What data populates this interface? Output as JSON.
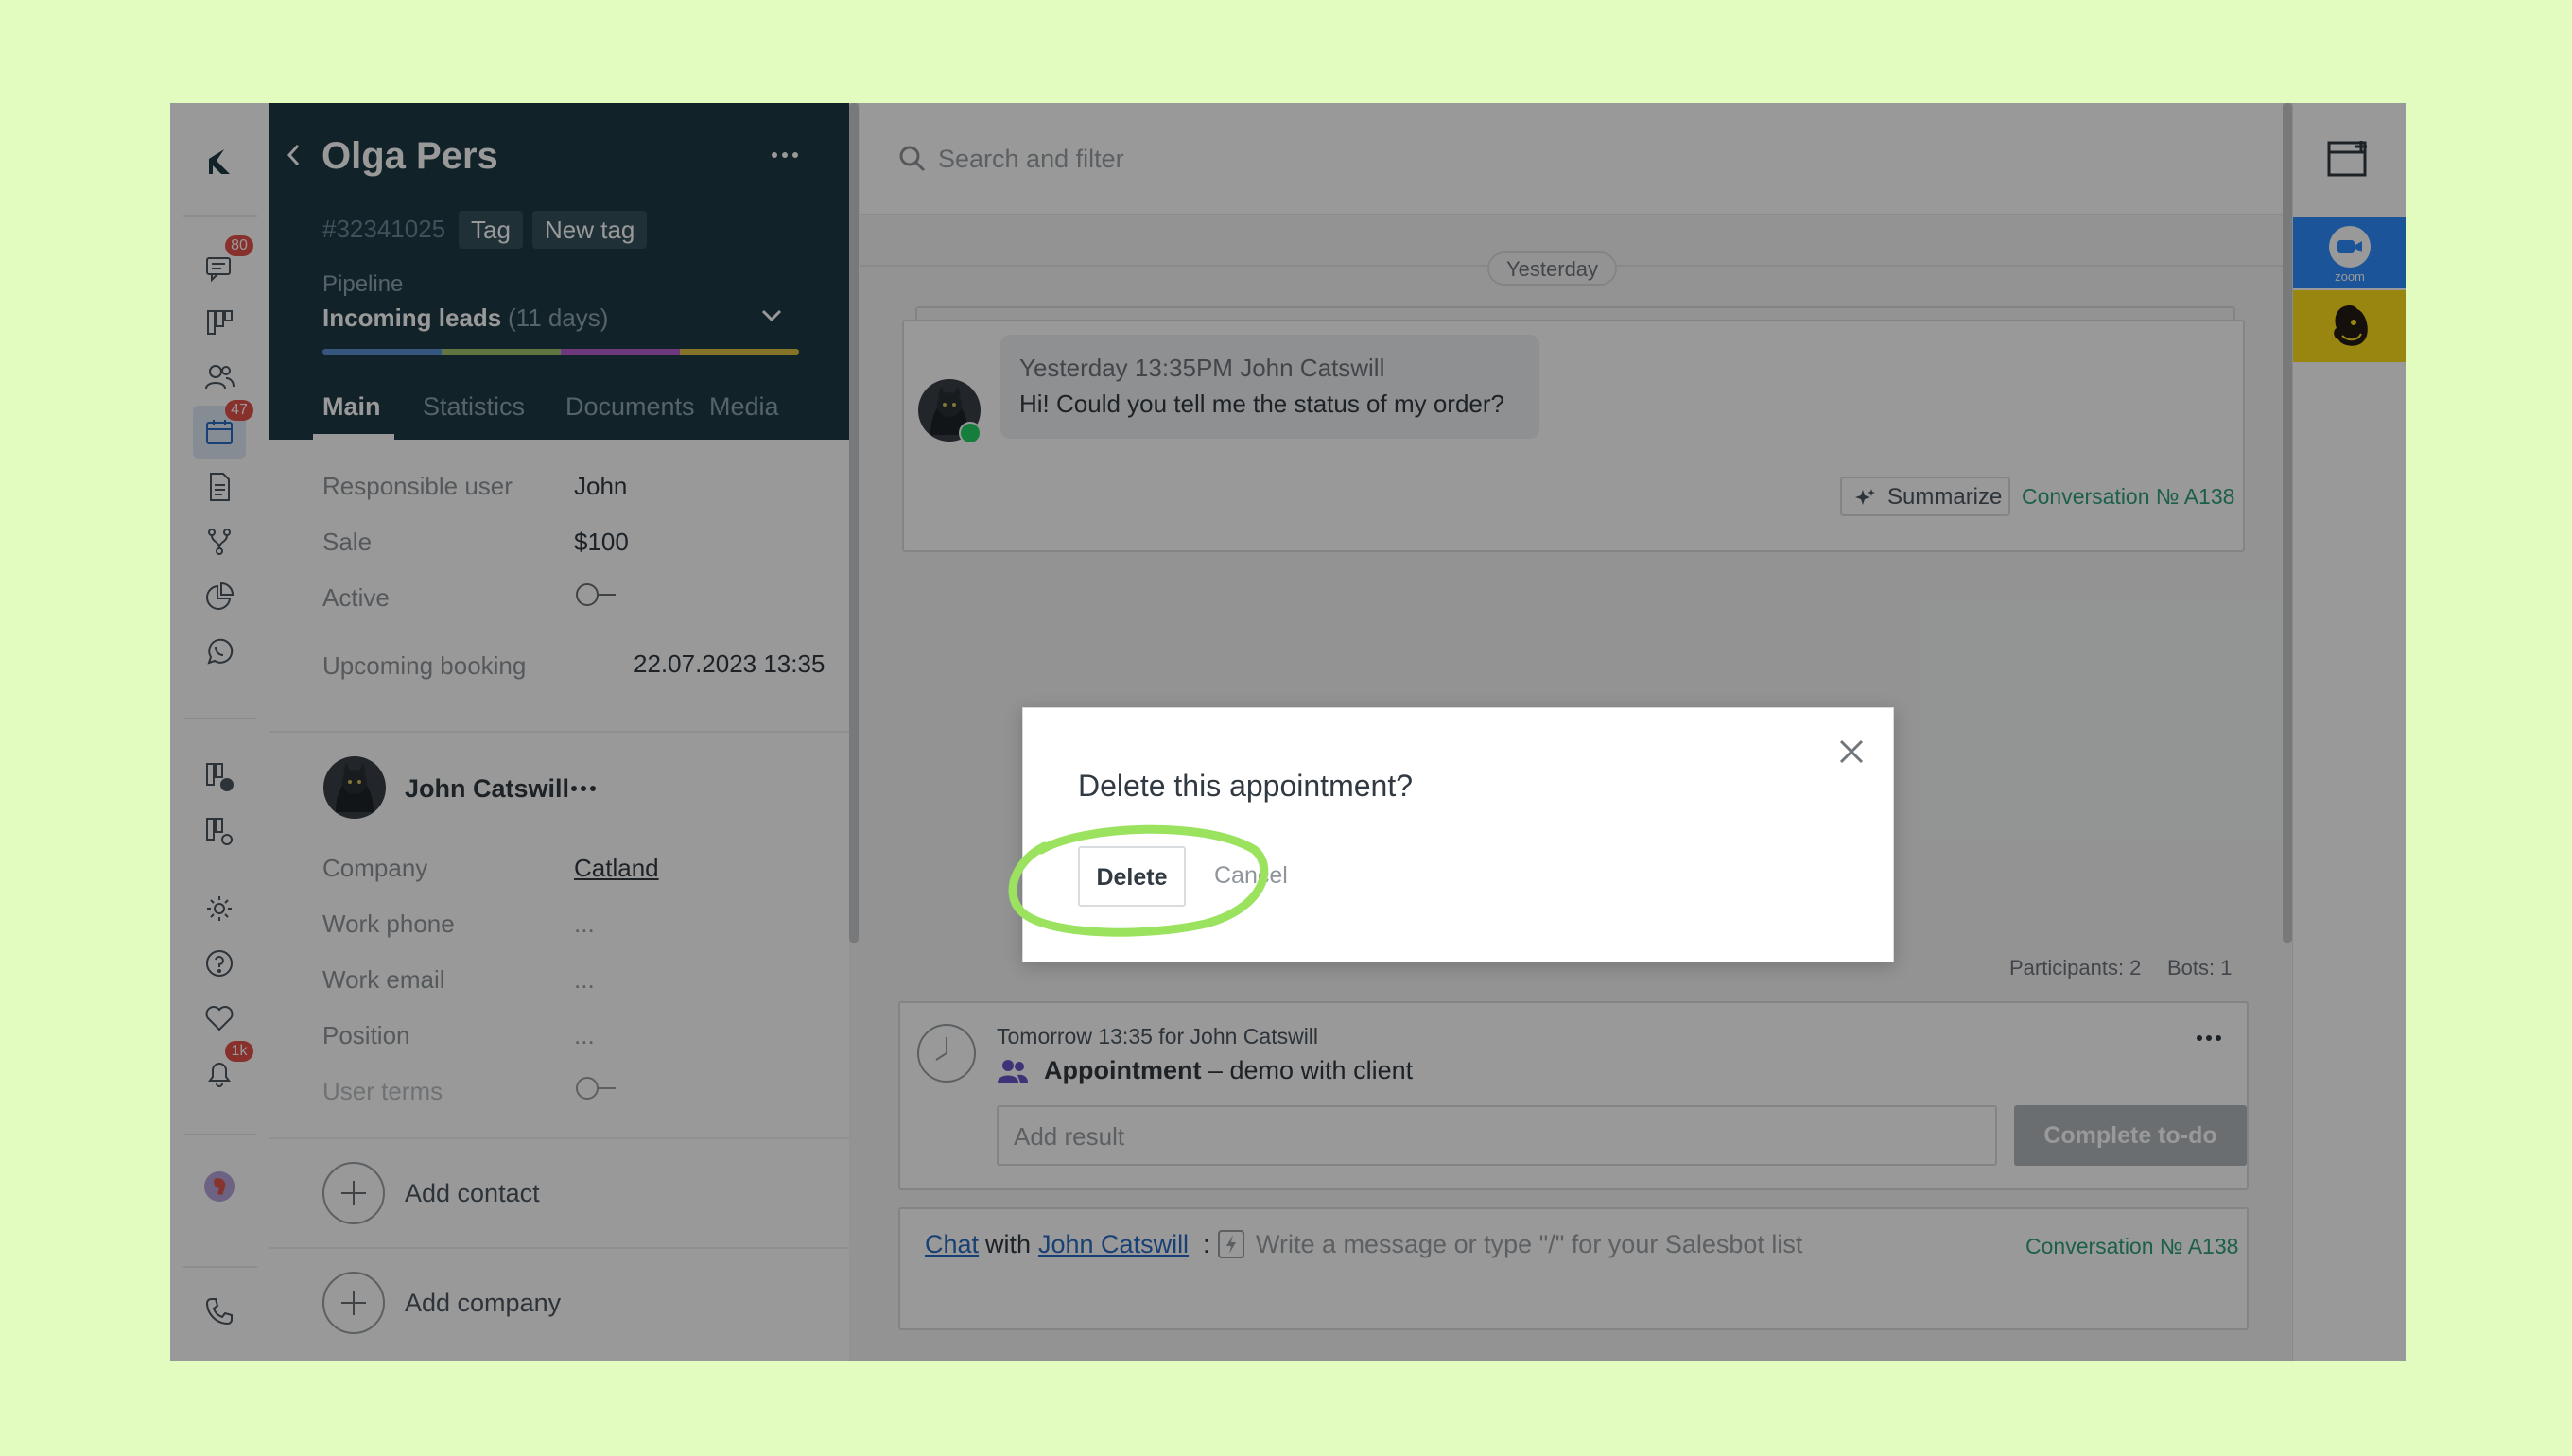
{
  "nav": {
    "chats_badge": "80",
    "calendar_badge": "47",
    "notifications_badge": "1k"
  },
  "lead": {
    "name": "Olga Pers",
    "id": "#32341025",
    "tags": [
      "Tag",
      "New tag"
    ],
    "pipeline_label": "Pipeline",
    "pipeline_stage": "Incoming leads",
    "pipeline_days": "(11 days)",
    "tabs": [
      "Main",
      "Statistics",
      "Documents",
      "Media"
    ],
    "fields": {
      "responsible_label": "Responsible user",
      "responsible_value": "John",
      "sale_label": "Sale",
      "sale_value": "$100",
      "active_label": "Active",
      "booking_label": "Upcoming booking",
      "booking_value": "22.07.2023 13:35"
    },
    "contact": {
      "name": "John Catswill",
      "company_label": "Company",
      "company_value": "Catland",
      "work_phone_label": "Work phone",
      "work_phone_value": "...",
      "work_email_label": "Work email",
      "work_email_value": "...",
      "position_label": "Position",
      "position_value": "...",
      "user_terms_label": "User terms"
    },
    "add_contact": "Add contact",
    "add_company": "Add company"
  },
  "feed": {
    "search_placeholder": "Search and filter",
    "date_divider": "Yesterday",
    "message_meta": "Yesterday 13:35PM John Catswill",
    "message_text": "Hi! Could you tell me the status of my order?",
    "summarize": "Summarize",
    "conversation": "Conversation № A138",
    "participants": "Participants: 2",
    "bots": "Bots: 1",
    "task_meta": "Tomorrow 13:35 for John Catswill",
    "task_type": "Appointment",
    "task_desc": "– demo with client",
    "add_result_placeholder": "Add result",
    "complete_button": "Complete to-do",
    "composer_chat": "Chat",
    "composer_with": "with",
    "composer_contact": "John Catswill",
    "composer_colon": ":",
    "composer_placeholder": "Write a message or type \"/\" for your Salesbot list",
    "composer_conversation": "Conversation № A138"
  },
  "rail": {
    "zoom_label": "zoom"
  },
  "dialog": {
    "title": "Delete this appointment?",
    "delete": "Delete",
    "cancel": "Cancel"
  },
  "colors": {
    "lead_header": "#1f3a45",
    "accent_green": "#2f9e7e",
    "link_blue": "#2b6cc4",
    "highlight_ring": "#9be35f",
    "zoom_blue": "#2d8cff",
    "mailchimp_yellow": "#ffe01b"
  }
}
